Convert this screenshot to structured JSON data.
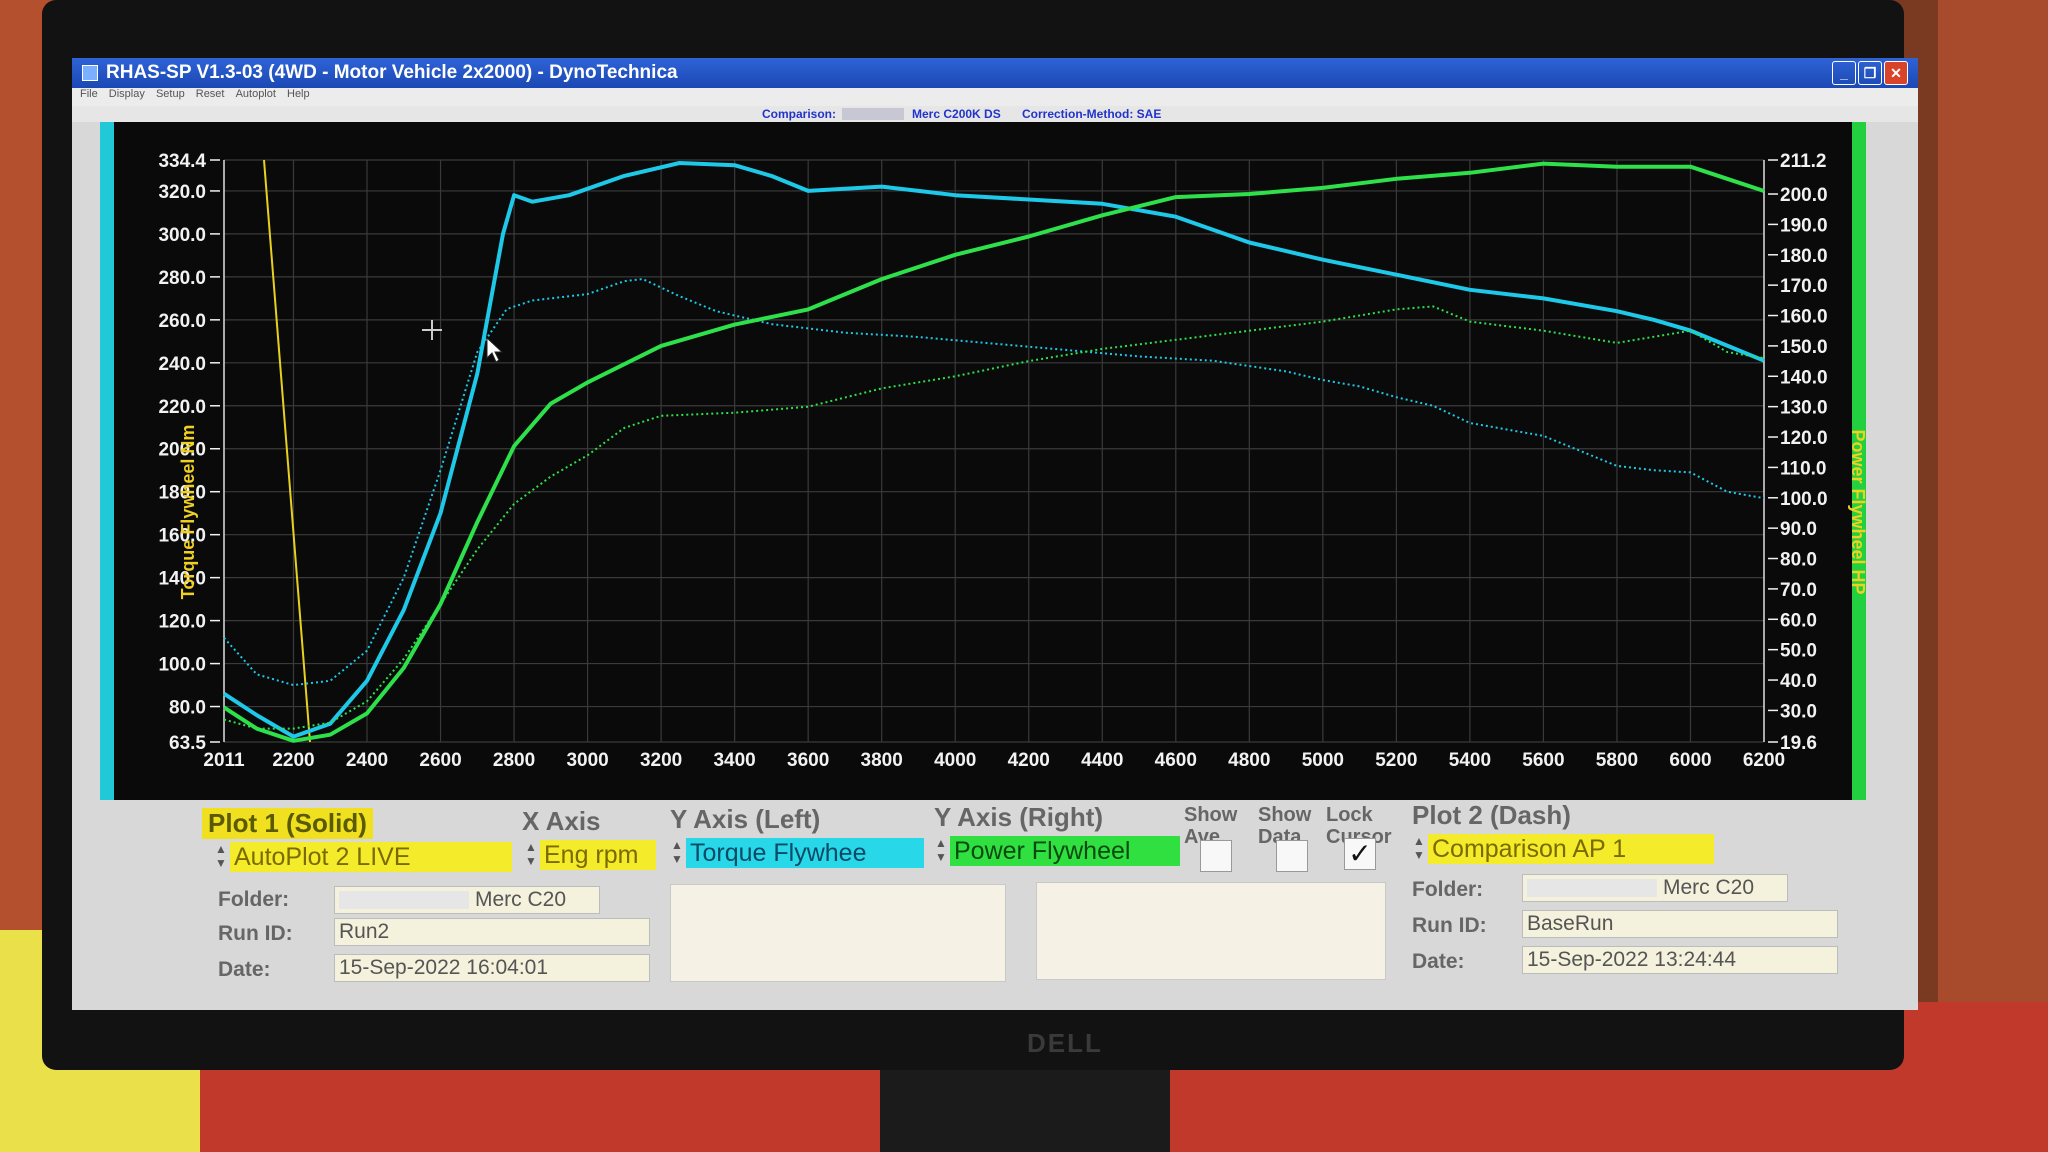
{
  "window": {
    "title": "RHAS-SP V1.3-03  (4WD - Motor Vehicle 2x2000) - DynoTechnica",
    "controls": [
      "_",
      "❐",
      "✕"
    ]
  },
  "menu": [
    "File",
    "Display",
    "Setup",
    "Reset",
    "Autoplot",
    "Help"
  ],
  "plot_header": {
    "comparison_label": "Comparison:",
    "run_name": "Merc C200K DS",
    "correction_method": "Correction-Method: SAE"
  },
  "chart_data": {
    "type": "line",
    "x": {
      "label": "",
      "min": 2011,
      "max": 6200,
      "ticks": [
        "2011",
        "2200",
        "2400",
        "2600",
        "2800",
        "3000",
        "3200",
        "3400",
        "3600",
        "3800",
        "4000",
        "4200",
        "4400",
        "4600",
        "4800",
        "5000",
        "5200",
        "5400",
        "5600",
        "5800",
        "6000",
        "6200"
      ]
    },
    "y_left": {
      "label": "Torque Flywheel Nm",
      "min": 63.5,
      "max": 334.4,
      "ticks": [
        "63.5",
        "80.0",
        "100.0",
        "120.0",
        "140.0",
        "160.0",
        "180.0",
        "200.0",
        "220.0",
        "240.0",
        "260.0",
        "280.0",
        "300.0",
        "320.0",
        "334.4"
      ]
    },
    "y_right": {
      "label": "Power Flywheel HP",
      "min": 19.6,
      "max": 211.2,
      "ticks": [
        "19.6",
        "30.0",
        "40.0",
        "50.0",
        "60.0",
        "70.0",
        "80.0",
        "90.0",
        "100.0",
        "110.0",
        "120.0",
        "130.0",
        "140.0",
        "150.0",
        "160.0",
        "170.0",
        "180.0",
        "190.0",
        "200.0",
        "211.2"
      ]
    },
    "grid": true,
    "series": [
      {
        "name": "Torque Flywheel",
        "axis": "left",
        "style": "solid",
        "color": "#1ec8e8",
        "points": [
          [
            2011,
            86
          ],
          [
            2100,
            76
          ],
          [
            2200,
            66
          ],
          [
            2300,
            72
          ],
          [
            2400,
            92
          ],
          [
            2500,
            125
          ],
          [
            2600,
            170
          ],
          [
            2700,
            235
          ],
          [
            2770,
            300
          ],
          [
            2800,
            318
          ],
          [
            2850,
            315
          ],
          [
            2950,
            318
          ],
          [
            3100,
            327
          ],
          [
            3250,
            333
          ],
          [
            3400,
            332
          ],
          [
            3500,
            327
          ],
          [
            3600,
            320
          ],
          [
            3800,
            322
          ],
          [
            3900,
            320
          ],
          [
            4000,
            318
          ],
          [
            4200,
            316
          ],
          [
            4400,
            314
          ],
          [
            4600,
            308
          ],
          [
            4700,
            302
          ],
          [
            4800,
            296
          ],
          [
            4900,
            292
          ],
          [
            5000,
            288
          ],
          [
            5200,
            281
          ],
          [
            5400,
            274
          ],
          [
            5600,
            270
          ],
          [
            5800,
            264
          ],
          [
            5900,
            260
          ],
          [
            6000,
            255
          ],
          [
            6100,
            248
          ],
          [
            6200,
            241
          ]
        ]
      },
      {
        "name": "Torque Flywheel",
        "axis": "left",
        "style": "dash",
        "color": "#1ec8e8",
        "points": [
          [
            2011,
            112
          ],
          [
            2100,
            95
          ],
          [
            2200,
            90
          ],
          [
            2300,
            92
          ],
          [
            2400,
            106
          ],
          [
            2500,
            140
          ],
          [
            2600,
            190
          ],
          [
            2700,
            245
          ],
          [
            2780,
            265
          ],
          [
            2850,
            269
          ],
          [
            3000,
            272
          ],
          [
            3100,
            278
          ],
          [
            3150,
            279
          ],
          [
            3250,
            271
          ],
          [
            3350,
            264
          ],
          [
            3500,
            258
          ],
          [
            3700,
            254
          ],
          [
            3900,
            252
          ],
          [
            4100,
            249
          ],
          [
            4300,
            246
          ],
          [
            4500,
            243
          ],
          [
            4700,
            241
          ],
          [
            4900,
            236
          ],
          [
            5000,
            232
          ],
          [
            5100,
            229
          ],
          [
            5200,
            224
          ],
          [
            5300,
            220
          ],
          [
            5400,
            212
          ],
          [
            5600,
            206
          ],
          [
            5700,
            199
          ],
          [
            5800,
            192
          ],
          [
            5900,
            190
          ],
          [
            6000,
            189
          ],
          [
            6100,
            180
          ],
          [
            6200,
            177
          ]
        ]
      },
      {
        "name": "Power Flywheel",
        "axis": "right",
        "style": "solid",
        "color": "#2ee04a",
        "points": [
          [
            2011,
            31
          ],
          [
            2100,
            24
          ],
          [
            2200,
            20
          ],
          [
            2300,
            22
          ],
          [
            2400,
            29
          ],
          [
            2500,
            44
          ],
          [
            2600,
            65
          ],
          [
            2700,
            92
          ],
          [
            2800,
            117
          ],
          [
            2900,
            131
          ],
          [
            3000,
            138
          ],
          [
            3200,
            150
          ],
          [
            3400,
            157
          ],
          [
            3600,
            162
          ],
          [
            3800,
            172
          ],
          [
            4000,
            180
          ],
          [
            4200,
            186
          ],
          [
            4400,
            193
          ],
          [
            4600,
            199
          ],
          [
            4800,
            200
          ],
          [
            5000,
            202
          ],
          [
            5200,
            205
          ],
          [
            5400,
            207
          ],
          [
            5600,
            210
          ],
          [
            5800,
            209
          ],
          [
            6000,
            209
          ],
          [
            6100,
            205
          ],
          [
            6200,
            201
          ]
        ]
      },
      {
        "name": "Power Flywheel",
        "axis": "right",
        "style": "dash",
        "color": "#2ee04a",
        "points": [
          [
            2011,
            27
          ],
          [
            2100,
            24
          ],
          [
            2200,
            24
          ],
          [
            2300,
            26
          ],
          [
            2400,
            33
          ],
          [
            2500,
            47
          ],
          [
            2600,
            65
          ],
          [
            2700,
            83
          ],
          [
            2800,
            98
          ],
          [
            2900,
            107
          ],
          [
            3000,
            114
          ],
          [
            3100,
            123
          ],
          [
            3200,
            127
          ],
          [
            3400,
            128
          ],
          [
            3600,
            130
          ],
          [
            3800,
            136
          ],
          [
            4000,
            140
          ],
          [
            4200,
            145
          ],
          [
            4400,
            149
          ],
          [
            4600,
            152
          ],
          [
            4800,
            155
          ],
          [
            5000,
            158
          ],
          [
            5200,
            162
          ],
          [
            5300,
            163
          ],
          [
            5400,
            158
          ],
          [
            5600,
            155
          ],
          [
            5800,
            151
          ],
          [
            6000,
            155
          ],
          [
            6100,
            148
          ],
          [
            6200,
            146
          ]
        ]
      }
    ]
  },
  "controls": {
    "plot1_title": "Plot 1 (Solid)",
    "x_axis_title": "X Axis",
    "y_left_title": "Y Axis (Left)",
    "y_right_title": "Y Axis (Right)",
    "show_ave_title": "Show Ave.",
    "show_data_title": "Show Data",
    "lock_cursor_title": "Lock Cursor",
    "plot2_title": "Plot 2 (Dash)",
    "plot1_select": "AutoPlot 2 LIVE",
    "x_axis_select": "Eng rpm",
    "y_left_select": "Torque Flywhee",
    "y_right_select": "Power Flywheel",
    "plot2_select": "Comparison AP 1",
    "show_ave_checked": false,
    "show_data_checked": false,
    "lock_cursor_checked": true,
    "lock_cursor_mark": "✓",
    "plot1": {
      "folder_label": "Folder:",
      "folder_value": "Merc C20",
      "runid_label": "Run ID:",
      "runid_value": "Run2",
      "date_label": "Date:",
      "date_value": "15-Sep-2022  16:04:01"
    },
    "plot2": {
      "folder_label": "Folder:",
      "folder_value": "Merc C20",
      "runid_label": "Run ID:",
      "runid_value": "BaseRun",
      "date_label": "Date:",
      "date_value": "15-Sep-2022  13:24:44"
    }
  },
  "monitor_brand": "DELL"
}
